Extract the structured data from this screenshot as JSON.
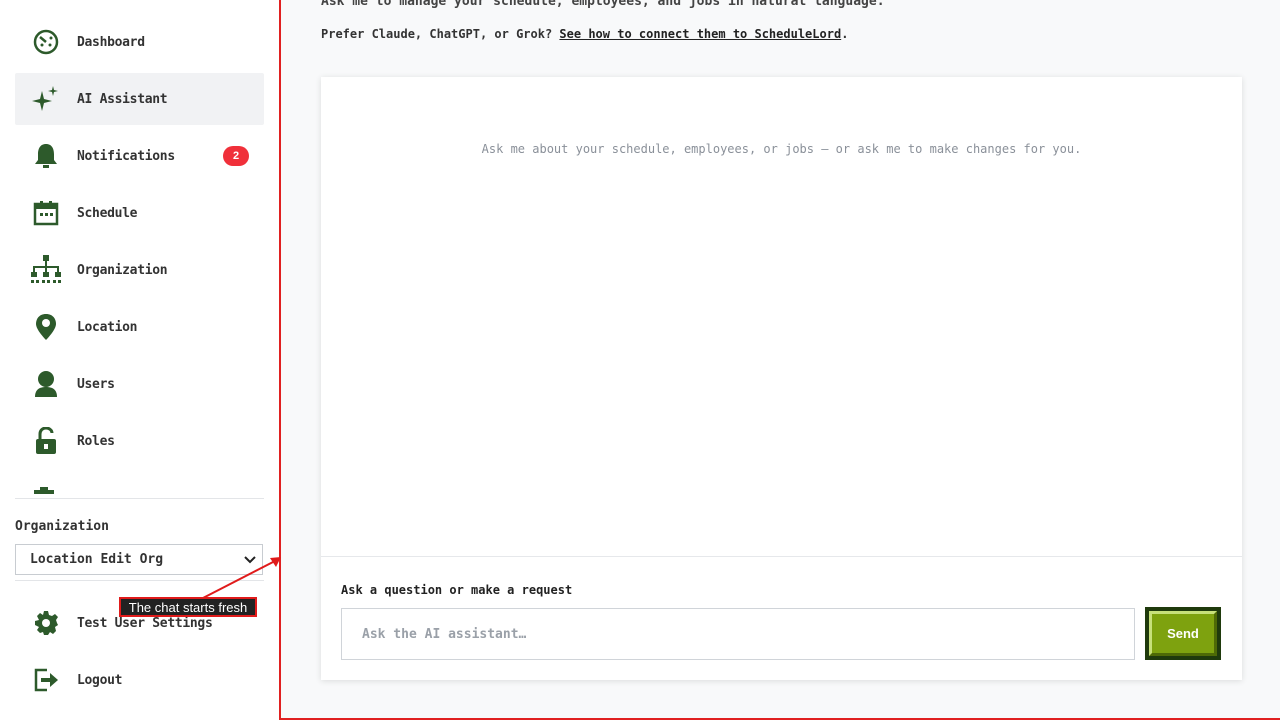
{
  "colors": {
    "icon_green": "#2d5a2b",
    "accent_red": "#e02020",
    "badge_red": "#f0303a",
    "send_green": "#7ea20f",
    "send_dark": "#1f3a0c"
  },
  "sidebar": {
    "items": [
      {
        "label": "Dashboard",
        "icon": "dashboard-icon"
      },
      {
        "label": "AI Assistant",
        "icon": "sparkle-icon",
        "active": true
      },
      {
        "label": "Notifications",
        "icon": "bell-icon",
        "badge": "2"
      },
      {
        "label": "Schedule",
        "icon": "calendar-icon"
      },
      {
        "label": "Organization",
        "icon": "org-chart-icon"
      },
      {
        "label": "Location",
        "icon": "map-pin-icon"
      },
      {
        "label": "Users",
        "icon": "user-icon"
      },
      {
        "label": "Roles",
        "icon": "lock-icon"
      }
    ],
    "organization_label": "Organization",
    "organization_selected": "Location Edit Org",
    "bottom_items": [
      {
        "label": "Test User Settings",
        "icon": "gear-icon"
      },
      {
        "label": "Logout",
        "icon": "logout-icon"
      }
    ]
  },
  "annotation": {
    "text": "The chat starts fresh"
  },
  "main": {
    "intro": "Ask me to manage your schedule, employees, and jobs in natural language.",
    "connect_prefix": "Prefer Claude, ChatGPT, or Grok? ",
    "connect_link": "See how to connect them to ScheduleLord",
    "connect_suffix": ".",
    "empty_message": "Ask me about your schedule, employees, or jobs — or ask me to make changes for you.",
    "input_label": "Ask a question or make a request",
    "input_placeholder": "Ask the AI assistant…",
    "input_value": "",
    "send_label": "Send"
  }
}
